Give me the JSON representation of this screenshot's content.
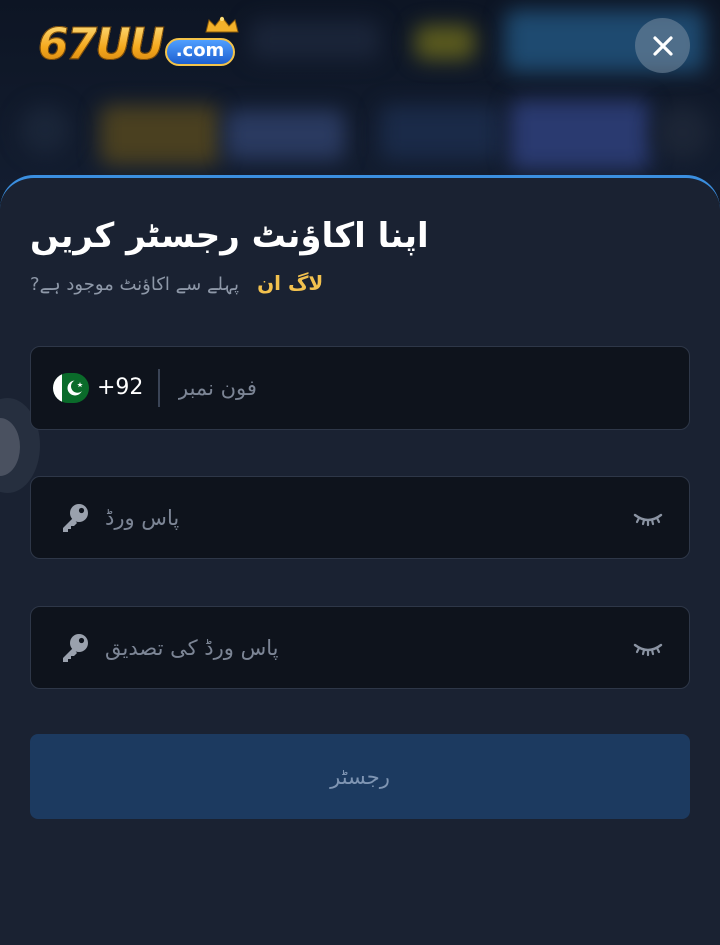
{
  "header": {
    "logo_text": "67UU",
    "logo_suffix": ".com",
    "close_label": "×"
  },
  "register": {
    "title": "اپنا اکاؤنٹ رجسٹر کریں",
    "have_account": "?پہلے سے اکاؤنٹ موجود ہے",
    "login_link": "لاگ ان",
    "phone": {
      "country_code": "+92",
      "placeholder": "فون نمبر",
      "value": ""
    },
    "password": {
      "placeholder": "پاس ورڈ",
      "value": ""
    },
    "confirm_password": {
      "placeholder": "پاس ورڈ کی تصدیق",
      "value": ""
    },
    "submit_label": "رجسٹر"
  },
  "icons": {
    "flag": "pakistan-flag-icon",
    "key": "key-icon",
    "eye_hidden": "eye-closed-icon",
    "close": "close-icon",
    "crown": "crown-icon"
  },
  "colors": {
    "accent_gold": "#f2c14e",
    "panel_bg": "#1a2232",
    "field_bg": "#0e131c",
    "button_bg": "#1c3a60",
    "panel_border": "#3b8fe0"
  }
}
